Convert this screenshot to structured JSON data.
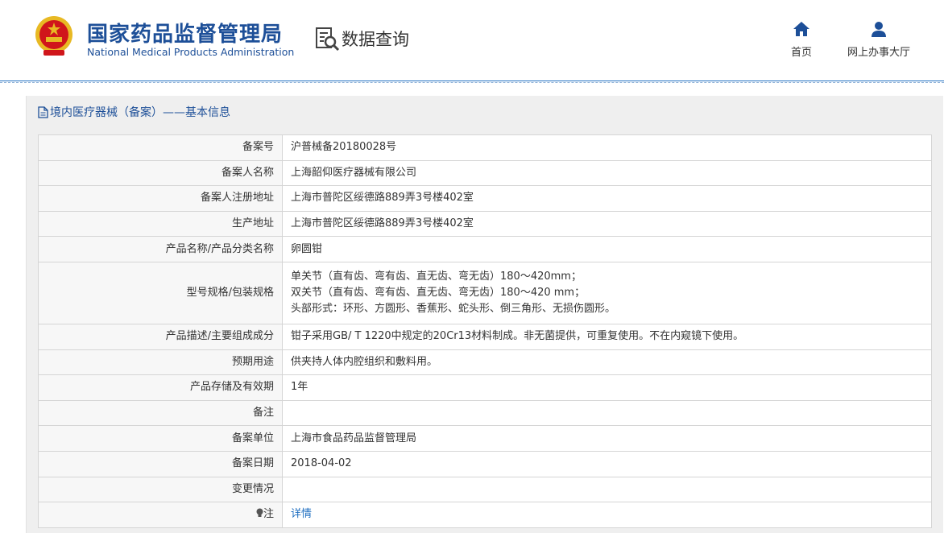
{
  "header": {
    "logo_cn": "国家药品监督管理局",
    "logo_en": "National Medical Products Administration",
    "data_query_label": "数据查询",
    "nav": {
      "home_label": "首页",
      "hall_label": "网上办事大厅"
    }
  },
  "panel": {
    "title": "境内医疗器械（备案）——基本信息",
    "rows": [
      {
        "label": "备案号",
        "value": "沪普械备20180028号"
      },
      {
        "label": "备案人名称",
        "value": "上海韶仰医疗器械有限公司"
      },
      {
        "label": "备案人注册地址",
        "value": "上海市普陀区绥德路889弄3号楼402室"
      },
      {
        "label": "生产地址",
        "value": "上海市普陀区绥德路889弄3号楼402室"
      },
      {
        "label": "产品名称/产品分类名称",
        "value": "卵圆钳"
      },
      {
        "label": "型号规格/包装规格",
        "lines": [
          "单关节（直有齿、弯有齿、直无齿、弯无齿）180～420mm；",
          "双关节（直有齿、弯有齿、直无齿、弯无齿）180～420 mm；",
          "头部形式：环形、方圆形、香蕉形、蛇头形、倒三角形、无损伤圆形。"
        ]
      },
      {
        "label": "产品描述/主要组成成分",
        "value": "钳子采用GB/ T 1220中规定的20Cr13材料制成。非无菌提供，可重复使用。不在内窥镜下使用。"
      },
      {
        "label": "预期用途",
        "value": "供夹持人体内腔组织和敷料用。"
      },
      {
        "label": "产品存储及有效期",
        "value": "1年"
      },
      {
        "label": "备注",
        "value": ""
      },
      {
        "label": "备案单位",
        "value": "上海市食品药品监督管理局"
      },
      {
        "label": "备案日期",
        "value": "2018-04-02"
      },
      {
        "label": "变更情况",
        "value": ""
      },
      {
        "label": "注",
        "value": "详情"
      }
    ]
  },
  "colors": {
    "brand_blue": "#1d4f98",
    "link_blue": "#1e6ec0",
    "emblem_red": "#d0161b",
    "emblem_gold": "#e8b923"
  }
}
